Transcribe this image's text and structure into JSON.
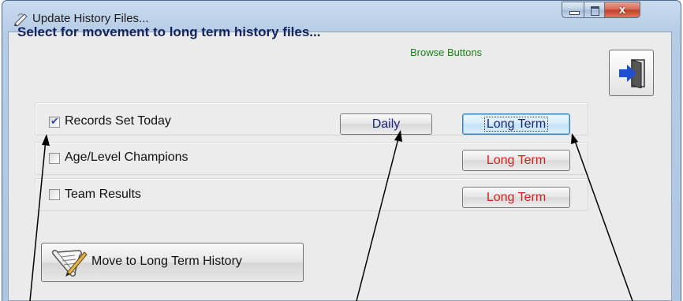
{
  "window": {
    "title": "Update History Files...",
    "close_glyph": "x"
  },
  "main": {
    "heading": "Select for movement to long term history files...",
    "browse_caption": "Browse Buttons"
  },
  "rows": [
    {
      "label": "Records Set Today",
      "checked": true,
      "daily_label": "Daily",
      "long_term_label": "Long Term"
    },
    {
      "label": "Age/Level Champions",
      "checked": false,
      "long_term_label": "Long Term"
    },
    {
      "label": "Team Results",
      "checked": false,
      "long_term_label": "Long Term"
    }
  ],
  "move_button": {
    "label": "Move to Long Term History"
  },
  "icons": {
    "title": "pen-icon",
    "exit": "exit-door-icon",
    "move": "scroll-quill-icon"
  },
  "colors": {
    "heading": "#14245e",
    "browse_caption": "#1d7f18",
    "long_term_text": "#d91c1c",
    "selected_button_text": "#1a237e"
  }
}
